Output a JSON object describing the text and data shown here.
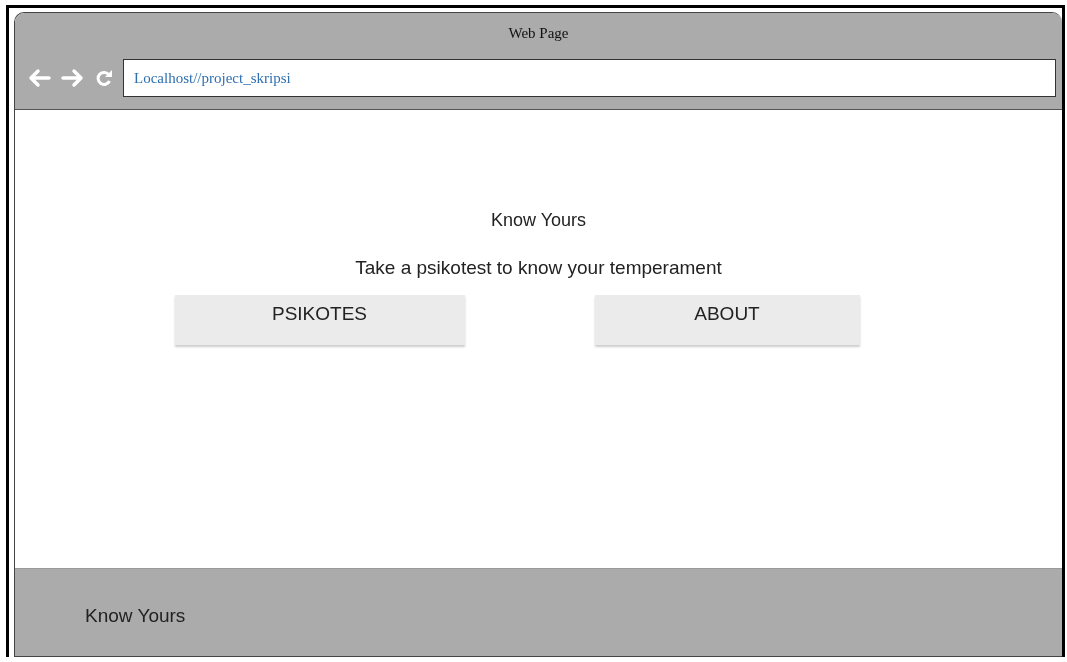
{
  "window": {
    "title": "Web Page"
  },
  "address_bar": {
    "url": "Localhost//project_skripsi"
  },
  "hero": {
    "title": "Know Yours",
    "subtitle": "Take a psikotest to know your temperament"
  },
  "buttons": [
    {
      "label": "PSIKOTES"
    },
    {
      "label": "ABOUT"
    }
  ],
  "footer": {
    "text": "Know Yours"
  }
}
